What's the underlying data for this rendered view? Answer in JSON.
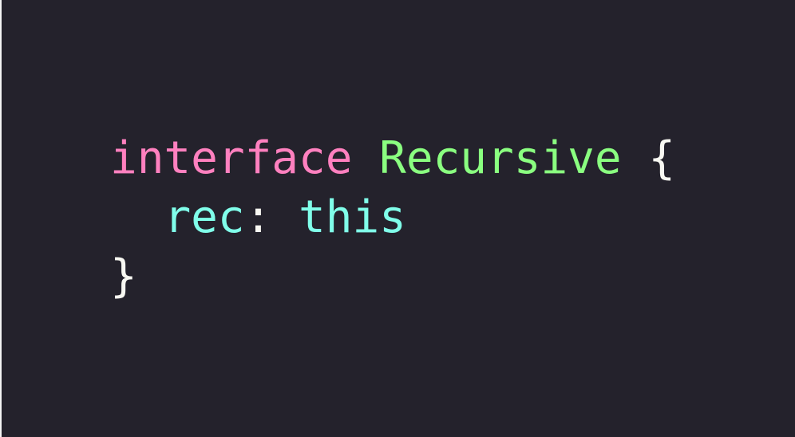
{
  "colors": {
    "background": "#24222c",
    "keyword": "#ff80bf",
    "type_name": "#8aff80",
    "property": "#80ffea",
    "punctuation": "#f8f8f2"
  },
  "code": {
    "line1": {
      "keyword": "interface",
      "space": " ",
      "type_name": "Recursive",
      "space2": " ",
      "open_brace": "{"
    },
    "line2": {
      "indent": "  ",
      "property": "rec",
      "colon": ":",
      "space": " ",
      "type_ref": "this"
    },
    "line3": {
      "close_brace": "}"
    }
  }
}
